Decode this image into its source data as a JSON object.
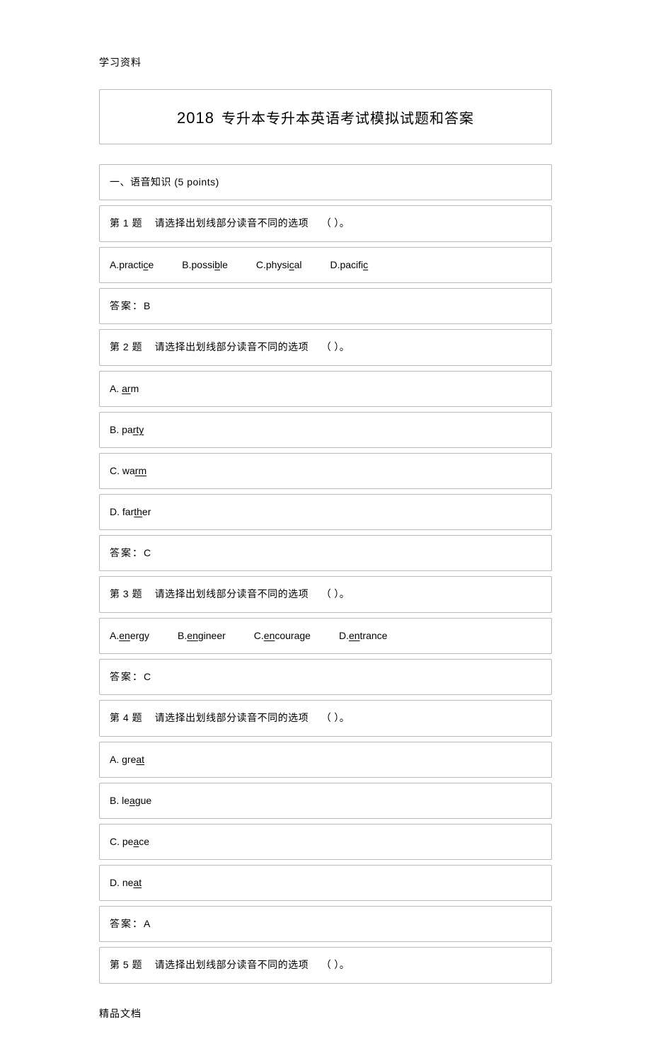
{
  "header_label": "学习资料",
  "footer_label": "精品文档",
  "title": {
    "year": "2018",
    "rest": "专升本专升本英语考试模拟试题和答案"
  },
  "section_heading": "一、语音知识  (5 points)",
  "q_prompt": "请选择出划线部分读音不同的选项",
  "q_paren": "（        ）。",
  "answer_label": "答案：",
  "q1": {
    "label": "第 1 题",
    "opts": [
      {
        "letter": "A.",
        "pre": "practi",
        "u": "c",
        "post": "e"
      },
      {
        "letter": "B.",
        "pre": "possi",
        "u": "b",
        "post": "le"
      },
      {
        "letter": "C.",
        "pre": "physi",
        "u": "c",
        "post": "al"
      },
      {
        "letter": "D.",
        "pre": "pacifi",
        "u": "c",
        "post": ""
      }
    ],
    "answer": "B"
  },
  "q2": {
    "label": "第 2 题",
    "opts": [
      {
        "letter": "A.",
        "pre": "",
        "u": "ar",
        "post": "m"
      },
      {
        "letter": "B.",
        "pre": "pa",
        "u": "rty",
        "post": ""
      },
      {
        "letter": "C.",
        "pre": "wa",
        "u": "rm",
        "post": ""
      },
      {
        "letter": "D.",
        "pre": "far",
        "u": "th",
        "post": "er"
      }
    ],
    "answer": "C"
  },
  "q3": {
    "label": "第 3 题",
    "opts": [
      {
        "letter": "A.",
        "pre": "",
        "u": "en",
        "post": "ergy"
      },
      {
        "letter": "B.",
        "pre": "",
        "u": "en",
        "post": "gineer"
      },
      {
        "letter": "C.",
        "pre": "",
        "u": "en",
        "post": "courage"
      },
      {
        "letter": "D.",
        "pre": "",
        "u": "en",
        "post": "trance"
      }
    ],
    "answer": "C"
  },
  "q4": {
    "label": "第 4 题",
    "opts": [
      {
        "letter": "A.",
        "pre": "gre",
        "u": "at",
        "post": ""
      },
      {
        "letter": "B.",
        "pre": "le",
        "u": "a",
        "post": "gue"
      },
      {
        "letter": "C.",
        "pre": "pe",
        "u": "a",
        "post": "ce"
      },
      {
        "letter": "D.",
        "pre": "ne",
        "u": "at",
        "post": ""
      }
    ],
    "answer": "A"
  },
  "q5": {
    "label": "第 5 题"
  }
}
